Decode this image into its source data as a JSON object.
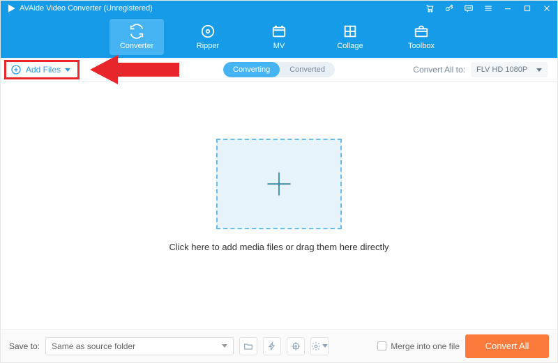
{
  "title": "AVAide Video Converter (Unregistered)",
  "nav": {
    "converter": "Converter",
    "ripper": "Ripper",
    "mv": "MV",
    "collage": "Collage",
    "toolbox": "Toolbox"
  },
  "subbar": {
    "add_files": "Add Files",
    "tab_converting": "Converting",
    "tab_converted": "Converted",
    "convert_all_to": "Convert All to:",
    "format": "FLV HD 1080P"
  },
  "content": {
    "drop_text": "Click here to add media files or drag them here directly"
  },
  "footer": {
    "save_to": "Save to:",
    "save_path": "Same as source folder",
    "merge": "Merge into one file",
    "convert_all": "Convert All"
  }
}
